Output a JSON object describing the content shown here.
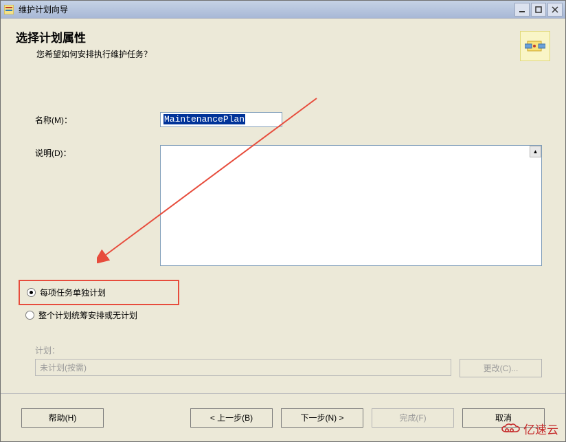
{
  "window": {
    "title": "维护计划向导"
  },
  "header": {
    "title": "选择计划属性",
    "subtitle": "您希望如何安排执行维护任务？"
  },
  "fields": {
    "name_label": "名称(M)：",
    "name_value": "MaintenancePlan",
    "desc_label": "说明(D)：",
    "desc_value": ""
  },
  "radios": {
    "opt1": "每项任务单独计划",
    "opt2": "整个计划统筹安排或无计划"
  },
  "schedule": {
    "label": "计划：",
    "value": "未计划(按需)",
    "change_btn": "更改(C)..."
  },
  "buttons": {
    "help": "帮助(H)",
    "back": "< 上一步(B)",
    "next": "下一步(N) >",
    "finish": "完成(F)",
    "cancel": "取消"
  },
  "watermark": "亿速云"
}
